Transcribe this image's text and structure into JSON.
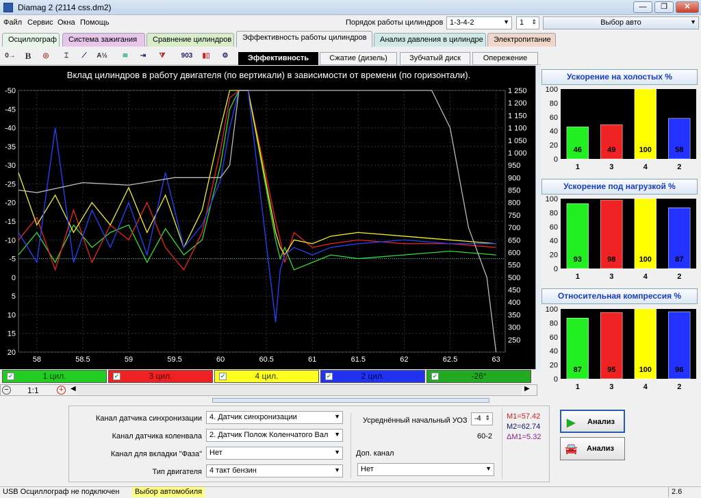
{
  "window": {
    "title": "Diamag 2 (2114 css.dm2)",
    "buttons": [
      "—",
      "❐",
      "✕"
    ]
  },
  "menu": [
    "Файл",
    "Сервис",
    "Окна",
    "Помощь"
  ],
  "cylinder_order": {
    "label": "Порядок работы цилиндров",
    "value": "1-3-4-2",
    "count": "1",
    "select_car": "Выбор авто"
  },
  "tabs": [
    "Осциллограф",
    "Система зажигания",
    "Сравнение цилиндров",
    "Эффективность работы цилиндров",
    "Анализ давления в цилиндре",
    "Электропитание"
  ],
  "tab_colors": [
    "#e8f4e8",
    "#e7c6ea",
    "#d8edc8",
    "#f0f0f0",
    "#cfe9e4",
    "#f1d7c9"
  ],
  "toolbar_icons": [
    "o-scale-icon",
    "bold-icon",
    "rpm-icon",
    "marker-icon",
    "line-icon",
    "algorithm-icon",
    "wave-icon",
    "export-icon",
    "filter-icon",
    "counter-icon",
    "bars-icon",
    "settings-icon"
  ],
  "subtabs": [
    "Эффективность",
    "Сжатие (дизель)",
    "Зубчатый диск",
    "Опережение"
  ],
  "chart_data": {
    "type": "line",
    "title": "Вклад цилиндров в работу двигателя (по вертикали) в зависимости от времени (по горизонтали).",
    "x_ticks": [
      "58",
      "58.5",
      "59",
      "59.5",
      "60",
      "60.5",
      "61",
      "61.5",
      "62",
      "62.5",
      "63"
    ],
    "y_left_ticks": [
      "-50",
      "-45",
      "-40",
      "-35",
      "-30",
      "-25",
      "-20",
      "-15",
      "-10",
      "-5",
      "0",
      "5",
      "10",
      "15",
      "20"
    ],
    "y_right_ticks": [
      "1 250",
      "1 200",
      "1 150",
      "1 100",
      "1 050",
      "1 000",
      "950",
      "900",
      "850",
      "800",
      "750",
      "700",
      "650",
      "600",
      "550",
      "500",
      "450",
      "400",
      "350",
      "300",
      "250"
    ],
    "xlim": [
      57.8,
      63.1
    ],
    "ylim": [
      -50,
      20
    ],
    "y2lim": [
      200,
      1250
    ],
    "series": [
      {
        "name": "1 цил.",
        "color": "#33dd33",
        "x": [
          57.8,
          58,
          58.2,
          58.4,
          58.6,
          58.8,
          59,
          59.2,
          59.4,
          59.6,
          59.8,
          60,
          60.1,
          60.2,
          60.3,
          60.6,
          60.65,
          60.7,
          60.8,
          61,
          61.2,
          61.5,
          62,
          62.5,
          63
        ],
        "y": [
          -6,
          -12,
          -4,
          -14,
          -8,
          -12,
          -14,
          -4,
          -13,
          -6,
          -10,
          -30,
          -45,
          -52,
          -52,
          -10,
          -5,
          -8,
          -2,
          -4,
          -6,
          -5,
          -6,
          -7,
          -6
        ]
      },
      {
        "name": "3 цил.",
        "color": "#ee2222",
        "x": [
          57.8,
          58,
          58.2,
          58.4,
          58.6,
          58.8,
          59,
          59.2,
          59.4,
          59.6,
          59.8,
          60,
          60.1,
          60.2,
          60.3,
          60.6,
          60.65,
          60.7,
          60.8,
          61,
          61.2,
          61.5,
          62,
          62.5,
          63
        ],
        "y": [
          -10,
          -16,
          -2,
          -18,
          -4,
          -14,
          -10,
          -20,
          -8,
          -2,
          -12,
          -34,
          -48,
          -52,
          -52,
          -15,
          -10,
          -4,
          -12,
          -8,
          -9,
          -10,
          -9,
          -9,
          -8
        ]
      },
      {
        "name": "4 цил.",
        "color": "#f0f020",
        "x": [
          57.8,
          58,
          58.2,
          58.4,
          58.6,
          58.8,
          59,
          59.2,
          59.4,
          59.6,
          59.8,
          60,
          60.1,
          60.2,
          60.3,
          60.6,
          60.65,
          60.7,
          60.8,
          61,
          61.2,
          61.5,
          62,
          62.5,
          63
        ],
        "y": [
          -28,
          -14,
          -22,
          -12,
          -20,
          -14,
          -24,
          -12,
          -22,
          -8,
          -18,
          -40,
          -52,
          -52,
          -52,
          -12,
          -8,
          -6,
          -10,
          -9,
          -11,
          -12,
          -11,
          -10,
          -9
        ]
      },
      {
        "name": "2 цил.",
        "color": "#2244ff",
        "x": [
          57.8,
          58,
          58.2,
          58.4,
          58.6,
          58.8,
          59,
          59.2,
          59.4,
          59.6,
          59.8,
          60,
          60.1,
          60.2,
          60.3,
          60.6,
          60.65,
          60.7,
          60.8,
          61,
          61.2,
          61.5,
          62,
          62.5,
          63
        ],
        "y": [
          -12,
          -4,
          -40,
          -4,
          -18,
          -8,
          -20,
          -6,
          -28,
          -8,
          -14,
          -26,
          -40,
          -52,
          -52,
          12,
          -2,
          -6,
          -8,
          -6,
          -8,
          -9,
          -10,
          -9,
          -9
        ]
      },
      {
        "name": "-26°",
        "color": "#bbbbbb",
        "axis": "right",
        "x": [
          57.8,
          58,
          58.5,
          59,
          59.5,
          60,
          60.1,
          60.2,
          62.3,
          62.5,
          62.7,
          62.9,
          63
        ],
        "y": [
          850,
          840,
          880,
          870,
          900,
          900,
          950,
          1270,
          1270,
          1100,
          700,
          500,
          200
        ]
      }
    ],
    "hlines": [
      {
        "y": -5,
        "color": "#4dbfbf"
      }
    ]
  },
  "legend": [
    {
      "label": "1 цил.",
      "bg": "#22cc22",
      "fg": "#004400"
    },
    {
      "label": "3 цил.",
      "bg": "#ee2222",
      "fg": "#550000"
    },
    {
      "label": "4 цил.",
      "bg": "#ffff22",
      "fg": "#333300"
    },
    {
      "label": "2 цил.",
      "bg": "#2233ee",
      "fg": "#000055"
    },
    {
      "label": "-26°",
      "bg": "#22aa22",
      "fg": "#003300"
    }
  ],
  "zoom": {
    "label": "1:1"
  },
  "panels": [
    {
      "title": "Ускорение на холостых %",
      "categories": [
        "1",
        "3",
        "4",
        "2"
      ],
      "values": [
        46,
        49,
        100,
        58
      ],
      "ylim": [
        0,
        100
      ]
    },
    {
      "title": "Ускорение под нагрузкой %",
      "categories": [
        "1",
        "3",
        "4",
        "2"
      ],
      "values": [
        93,
        98,
        100,
        87
      ],
      "ylim": [
        0,
        100
      ]
    },
    {
      "title": "Относительная компрессия %",
      "categories": [
        "1",
        "3",
        "4",
        "2"
      ],
      "values": [
        87,
        95,
        100,
        96
      ],
      "ylim": [
        0,
        100
      ]
    }
  ],
  "bar_colors": [
    "#22ee22",
    "#ee2222",
    "#ffff00",
    "#2233ff"
  ],
  "settings": {
    "sync_label": "Канал датчика синхронизации",
    "sync_value": "4.  Датчик синхронизации",
    "crank_label": "Канал датчика коленвала",
    "crank_value": "2.  Датчик Полож Коленчатого Вал",
    "phase_label": "Канал для вкладки \"Фаза\"",
    "phase_value": "Нет",
    "engine_label": "Тип двигателя",
    "engine_value": "4 такт бензин",
    "uoz_label": "Усреднённый начальный УОЗ",
    "uoz_value": "-4",
    "teeth": "60-2",
    "extra_label": "Доп. канал",
    "extra_value": "Нет",
    "m1": "M1=57.42",
    "m2": "M2=62.74",
    "dm": "ΔM1=5.32"
  },
  "buttons": {
    "analyze1": "Анализ",
    "analyze2": "Анализ"
  },
  "status": {
    "usb": "USB Осциллограф не подключен",
    "car": "Выбор автомобиля",
    "version": "2.6"
  }
}
